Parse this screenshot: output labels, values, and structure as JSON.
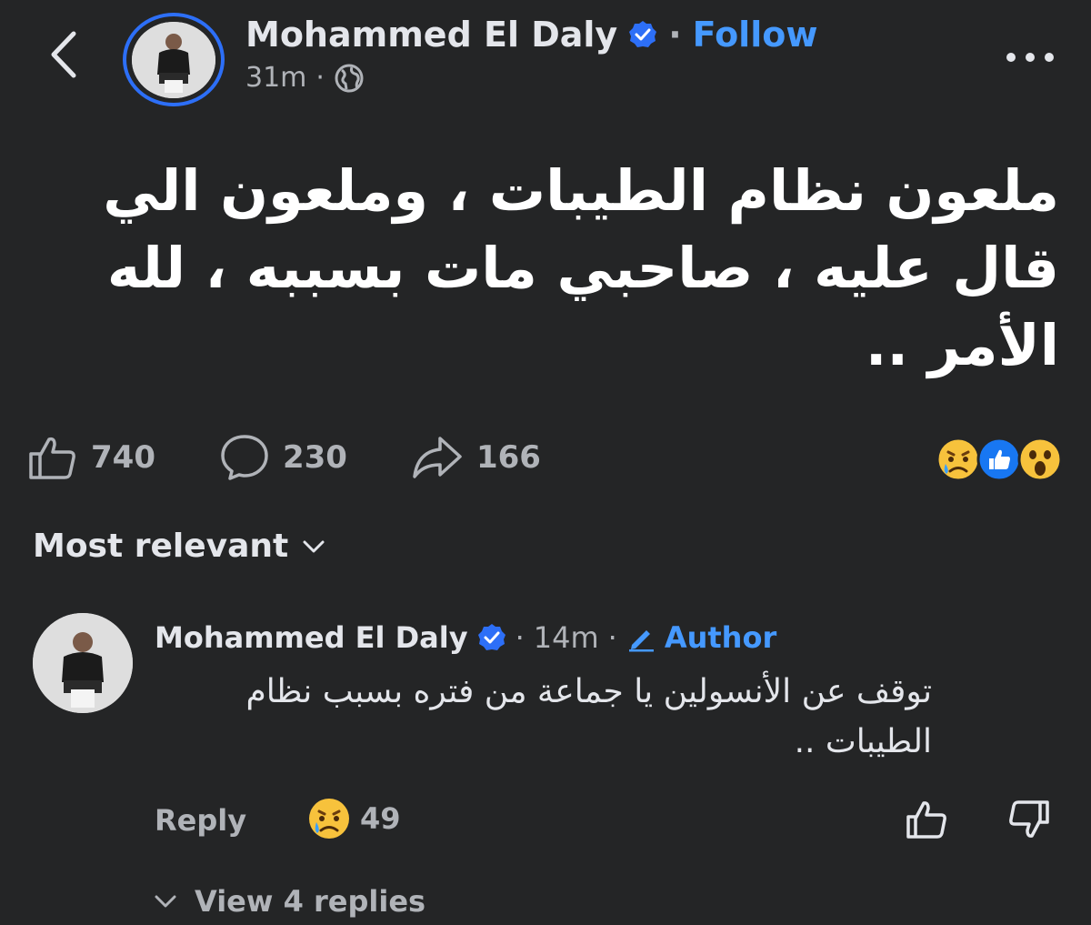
{
  "header": {
    "author_name": "Mohammed El Daly",
    "separator": "·",
    "follow_label": "Follow",
    "time_ago": "31m",
    "meta_separator": "·"
  },
  "post": {
    "text": "ملعون نظام الطيبات ، وملعون الي قال عليه ، صاحبي مات بسببه ، لله الأمر .."
  },
  "stats": {
    "likes": "740",
    "comments": "230",
    "shares": "166"
  },
  "comments_section": {
    "sort_label": "Most relevant"
  },
  "comment": {
    "author_name": "Mohammed El Daly",
    "separator": "·",
    "time_ago": "14m",
    "separator2": "·",
    "author_badge": "Author",
    "text": "توقف عن الأنسولين يا جماعة من فتره بسبب نظام الطيبات ..",
    "reply_label": "Reply",
    "reaction_count": "49",
    "view_replies_label": "View 4 replies"
  },
  "colors": {
    "background": "#242526",
    "accent": "#4599ff",
    "verified": "#2d6ff7",
    "secondary_text": "#b0b3b8"
  }
}
